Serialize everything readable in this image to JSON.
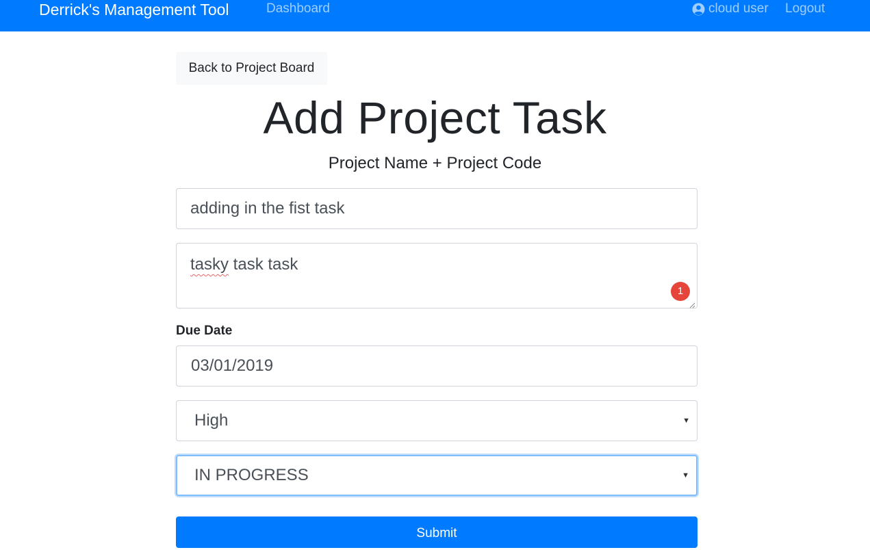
{
  "navbar": {
    "brand": "Derrick's Management Tool",
    "dashboard": "Dashboard",
    "user_name": "cloud user",
    "user_icon": "user-circle-icon",
    "logout": "Logout",
    "color": "#007bff"
  },
  "back_button": "Back to Project Board",
  "page": {
    "title": "Add Project Task",
    "subtitle": "Project Name + Project Code"
  },
  "form": {
    "summary_value": "adding in the fist task",
    "acceptance_word_misspelled": "tasky",
    "acceptance_rest": " task task",
    "spellcheck_count": "1",
    "due_date_label": "Due Date",
    "due_date_value": "03/01/2019",
    "priority_selected": "High",
    "status_selected": "IN PROGRESS",
    "submit_label": "Submit"
  }
}
